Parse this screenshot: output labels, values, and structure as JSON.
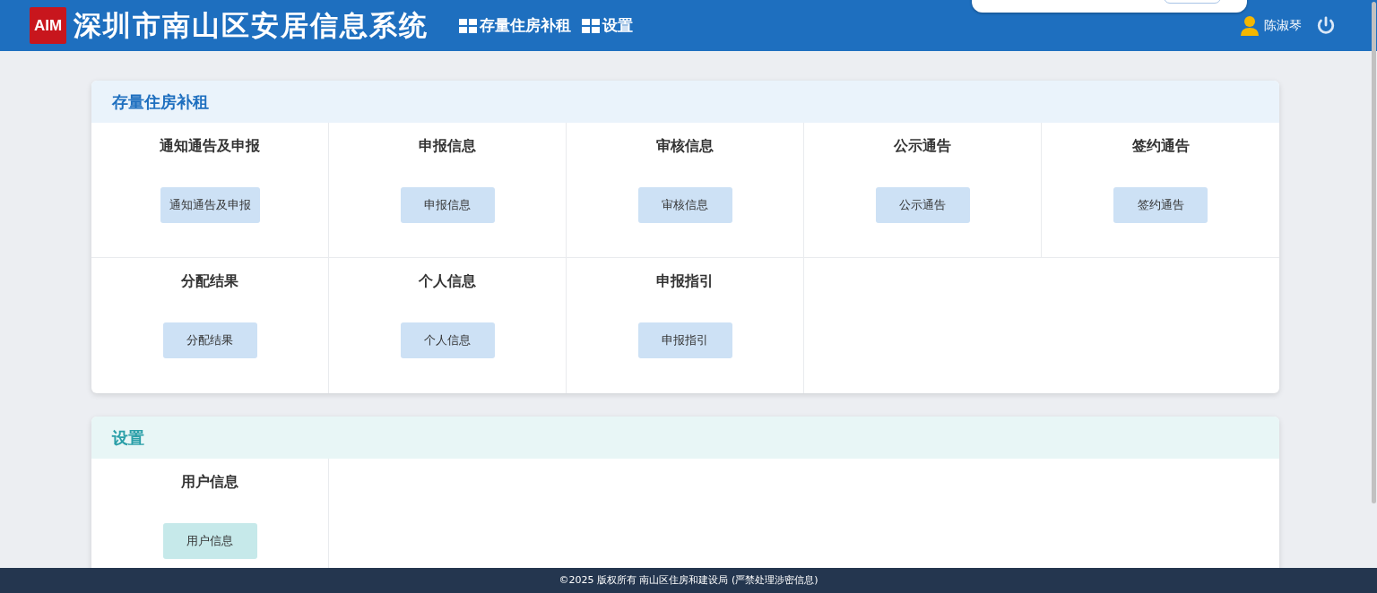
{
  "header": {
    "logo": "AIM",
    "title": "深圳市南山区安居信息系统",
    "nav": [
      "存量住房补租",
      "设置"
    ],
    "user": "陈淑琴"
  },
  "sections": [
    {
      "title": "存量住房补租",
      "kind": "housing",
      "items": [
        {
          "title": "通知通告及申报",
          "button": "通知通告及申报"
        },
        {
          "title": "申报信息",
          "button": "申报信息"
        },
        {
          "title": "审核信息",
          "button": "审核信息"
        },
        {
          "title": "公示通告",
          "button": "公示通告"
        },
        {
          "title": "签约通告",
          "button": "签约通告"
        },
        {
          "title": "分配结果",
          "button": "分配结果"
        },
        {
          "title": "个人信息",
          "button": "个人信息"
        },
        {
          "title": "申报指引",
          "button": "申报指引"
        }
      ]
    },
    {
      "title": "设置",
      "kind": "settings",
      "items": [
        {
          "title": "用户信息",
          "button": "用户信息"
        }
      ]
    }
  ],
  "footer": "©2025 版权所有 南山区住房和建设局 (严禁处理涉密信息)"
}
